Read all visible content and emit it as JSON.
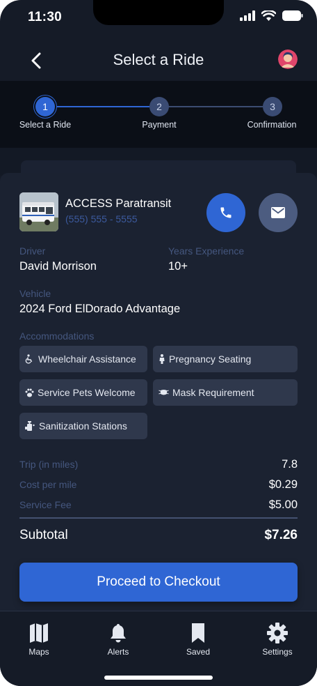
{
  "status_bar": {
    "time": "11:30"
  },
  "header": {
    "title": "Select a Ride"
  },
  "stepper": {
    "steps": [
      {
        "number": "1",
        "label": "Select a Ride"
      },
      {
        "number": "2",
        "label": "Payment"
      },
      {
        "number": "3",
        "label": "Confirmation"
      }
    ],
    "active_step": 1
  },
  "provider": {
    "name": "ACCESS Paratransit",
    "phone": "(555) 555 - 5555"
  },
  "details": {
    "driver_label": "Driver",
    "driver_value": "David Morrison",
    "experience_label": "Years Experience",
    "experience_value": "10+",
    "vehicle_label": "Vehicle",
    "vehicle_value": "2024 Ford ElDorado Advantage"
  },
  "accommodations": {
    "label": "Accommodations",
    "items": [
      {
        "label": "Wheelchair Assistance",
        "icon": "wheelchair-icon"
      },
      {
        "label": "Pregnancy Seating",
        "icon": "person-icon"
      },
      {
        "label": "Service Pets Welcome",
        "icon": "paw-icon"
      },
      {
        "label": "Mask Requirement",
        "icon": "mask-icon"
      },
      {
        "label": "Sanitization Stations",
        "icon": "sanitizer-icon"
      }
    ]
  },
  "pricing": {
    "trip_label": "Trip (in miles)",
    "trip_value": "7.8",
    "cost_label": "Cost per mile",
    "cost_value": "$0.29",
    "fee_label": "Service Fee",
    "fee_value": "$5.00",
    "subtotal_label": "Subtotal",
    "subtotal_value": "$7.26"
  },
  "checkout": {
    "label": "Proceed to Checkout"
  },
  "tabbar": {
    "items": [
      {
        "label": "Maps",
        "icon": "map-icon"
      },
      {
        "label": "Alerts",
        "icon": "bell-icon"
      },
      {
        "label": "Saved",
        "icon": "bookmark-icon"
      },
      {
        "label": "Settings",
        "icon": "gear-icon"
      }
    ]
  },
  "colors": {
    "background": "#151b27",
    "sheet": "#1b2231",
    "accent": "#2f66d4",
    "muted_label": "#45577f",
    "chip": "#2f384c"
  }
}
